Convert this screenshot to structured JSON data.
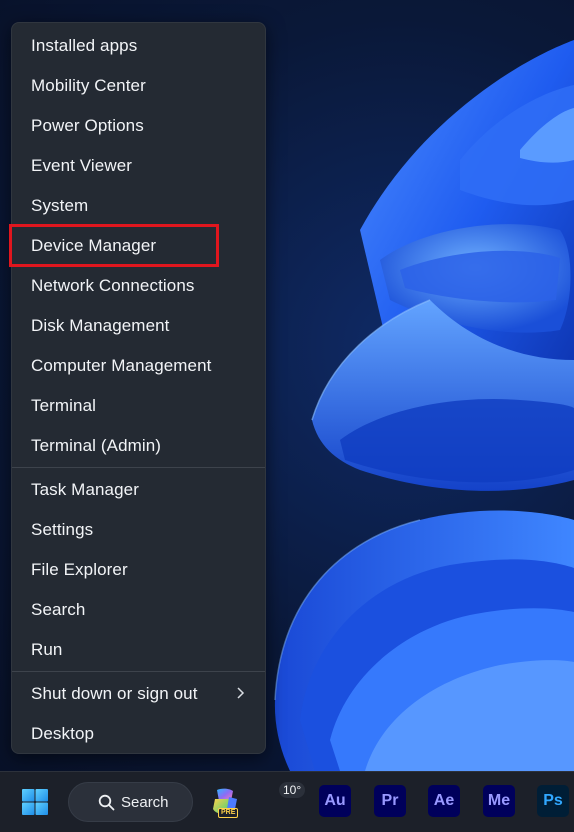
{
  "context_menu": {
    "group1": [
      {
        "label": "Installed apps"
      },
      {
        "label": "Mobility Center"
      },
      {
        "label": "Power Options"
      },
      {
        "label": "Event Viewer"
      },
      {
        "label": "System"
      },
      {
        "label": "Device Manager"
      },
      {
        "label": "Network Connections"
      },
      {
        "label": "Disk Management"
      },
      {
        "label": "Computer Management"
      },
      {
        "label": "Terminal"
      },
      {
        "label": "Terminal (Admin)"
      }
    ],
    "group2": [
      {
        "label": "Task Manager"
      },
      {
        "label": "Settings"
      },
      {
        "label": "File Explorer"
      },
      {
        "label": "Search"
      },
      {
        "label": "Run"
      }
    ],
    "group3": [
      {
        "label": "Shut down or sign out",
        "has_submenu": true
      },
      {
        "label": "Desktop"
      }
    ],
    "highlighted_item": "Device Manager"
  },
  "taskbar": {
    "search_label": "Search",
    "weather_temp": "10°",
    "copilot_badge": "PRE",
    "apps": [
      {
        "name": "Adobe Audition",
        "abbr": "Au",
        "color": "#9999ff"
      },
      {
        "name": "Adobe Premiere Pro",
        "abbr": "Pr",
        "color": "#9999ff"
      },
      {
        "name": "Adobe After Effects",
        "abbr": "Ae",
        "color": "#9999ff"
      },
      {
        "name": "Adobe Media Encoder",
        "abbr": "Me",
        "color": "#9999ff"
      },
      {
        "name": "Adobe Photoshop",
        "abbr": "Ps",
        "color": "#31a8ff"
      }
    ]
  },
  "colors": {
    "menu_background": "#242a33",
    "highlight_border": "#e0161e",
    "taskbar_background": "#1c2029",
    "adobe_tile": "#00005b"
  }
}
